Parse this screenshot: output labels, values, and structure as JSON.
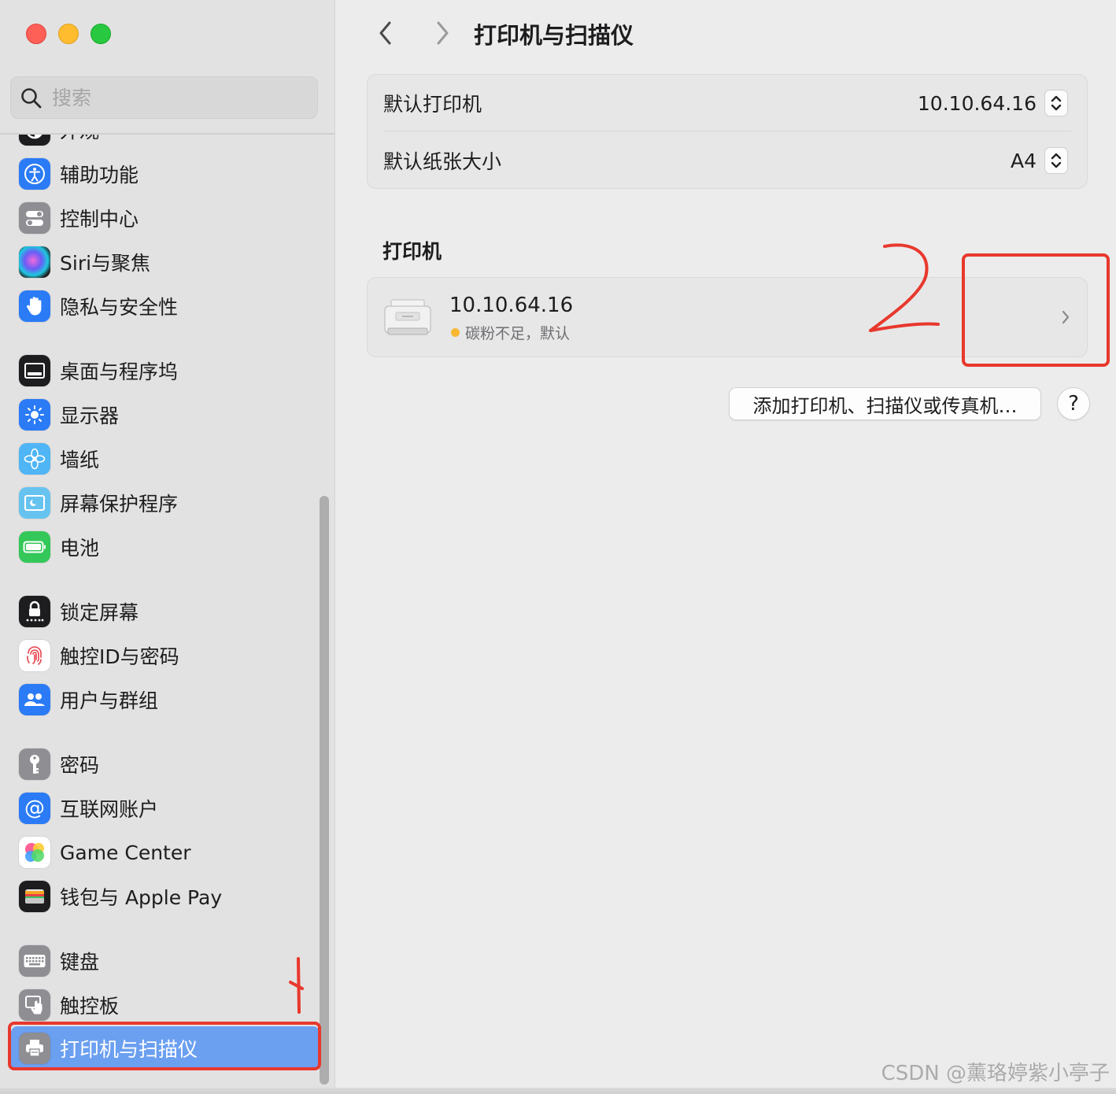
{
  "window": {
    "title": "打印机与扫描仪"
  },
  "search": {
    "placeholder": "搜索"
  },
  "sidebar": {
    "partial_item": "外观",
    "items": [
      {
        "label": "辅助功能",
        "icon": "accessibility-icon"
      },
      {
        "label": "控制中心",
        "icon": "control-center-icon"
      },
      {
        "label": "Siri与聚焦",
        "icon": "siri-icon"
      },
      {
        "label": "隐私与安全性",
        "icon": "hand-icon"
      },
      {
        "label": "桌面与程序坞",
        "icon": "dock-icon"
      },
      {
        "label": "显示器",
        "icon": "sun-icon"
      },
      {
        "label": "墙纸",
        "icon": "flower-icon"
      },
      {
        "label": "屏幕保护程序",
        "icon": "screensaver-icon"
      },
      {
        "label": "电池",
        "icon": "battery-icon"
      },
      {
        "label": "锁定屏幕",
        "icon": "lock-icon"
      },
      {
        "label": "触控ID与密码",
        "icon": "fingerprint-icon"
      },
      {
        "label": "用户与群组",
        "icon": "users-icon"
      },
      {
        "label": "密码",
        "icon": "key-icon"
      },
      {
        "label": "互联网账户",
        "icon": "at-icon"
      },
      {
        "label": "Game Center",
        "icon": "game-center-icon"
      },
      {
        "label": "钱包与 Apple Pay",
        "icon": "wallet-icon"
      },
      {
        "label": "键盘",
        "icon": "keyboard-icon"
      },
      {
        "label": "触控板",
        "icon": "trackpad-icon"
      },
      {
        "label": "打印机与扫描仪",
        "icon": "printer-icon",
        "selected": true
      }
    ]
  },
  "main": {
    "title": "打印机与扫描仪",
    "default_printer": {
      "label": "默认打印机",
      "value": "10.10.64.16"
    },
    "default_paper": {
      "label": "默认纸张大小",
      "value": "A4"
    },
    "printers_heading": "打印机",
    "printers": [
      {
        "name": "10.10.64.16",
        "status": "碳粉不足，默认",
        "status_color": "#f7b731"
      }
    ],
    "add_button": "添加打印机、扫描仪或传真机…",
    "help_button": "?"
  },
  "annotations": {
    "step1": "1",
    "step2": "2",
    "color": "#e8382d"
  },
  "watermark": "CSDN @薰珞婷紫小亭子",
  "colors": {
    "accent": "#6b9ff0"
  }
}
